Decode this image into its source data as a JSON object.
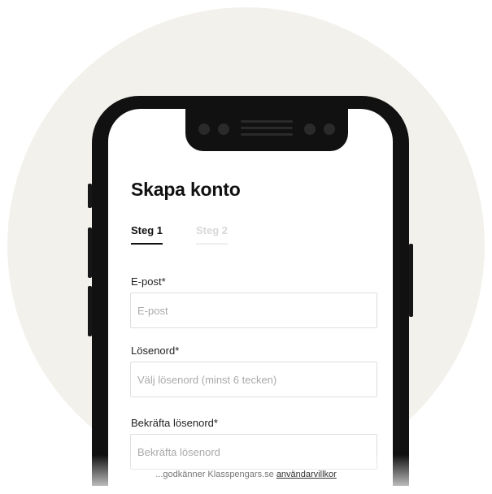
{
  "form": {
    "title": "Skapa konto",
    "steps": [
      {
        "label": "Steg 1",
        "active": true
      },
      {
        "label": "Steg 2",
        "active": false
      }
    ],
    "email": {
      "label": "E-post*",
      "placeholder": "E-post",
      "value": ""
    },
    "password": {
      "label": "Lösenord*",
      "placeholder": "Välj lösenord (minst 6 tecken)",
      "value": ""
    },
    "confirm": {
      "label": "Bekräfta lösenord*",
      "placeholder": "Bekräfta lösenord",
      "value": ""
    }
  },
  "terms": {
    "prefix": "...godkänner Klasspengars.se",
    "link": "användarvillkor"
  },
  "colors": {
    "background_circle": "#f3f1ec",
    "phone_frame": "#111111",
    "text": "#111111",
    "inactive_step": "#d8d8d8"
  }
}
